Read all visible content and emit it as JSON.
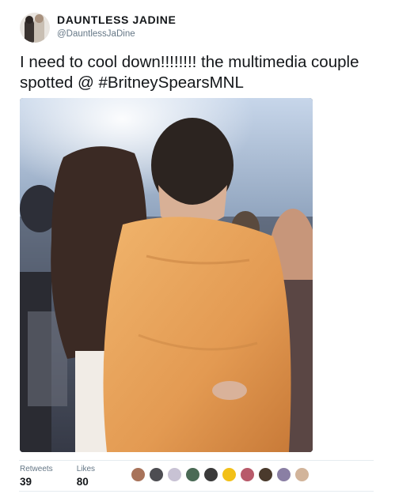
{
  "tweet": {
    "author": {
      "display_name": "DAUNTLESS JADINE",
      "handle": "@DauntlessJaDine",
      "avatar_icon": "profile-photo-couple"
    },
    "text": "I need to cool down!!!!!!!! the multimedia couple spotted @ #BritneySpearsMNL",
    "photo": {
      "subject": "couple-at-concert-photo",
      "colors": {
        "jacket": "#e8a45c",
        "hair": "#3b2a24",
        "stage_light": "#d8e4f2",
        "crowd": "#3c3f4c"
      }
    },
    "stats": {
      "retweets_label": "Retweets",
      "retweets_value": "39",
      "likes_label": "Likes",
      "likes_value": "80"
    },
    "likers": [
      {
        "name": "liker-avatar-1",
        "color": "#a8735a"
      },
      {
        "name": "liker-avatar-2",
        "color": "#4d4d52"
      },
      {
        "name": "liker-avatar-3",
        "color": "#c8c2d4"
      },
      {
        "name": "liker-avatar-4",
        "color": "#4a6a55"
      },
      {
        "name": "liker-avatar-5",
        "color": "#3a3a3a"
      },
      {
        "name": "liker-avatar-6",
        "color": "#f2c018"
      },
      {
        "name": "liker-avatar-7",
        "color": "#b85a6a"
      },
      {
        "name": "liker-avatar-8",
        "color": "#4a3a2c"
      },
      {
        "name": "liker-avatar-9",
        "color": "#8a7fa4"
      },
      {
        "name": "liker-avatar-10",
        "color": "#d2b49a"
      }
    ]
  }
}
